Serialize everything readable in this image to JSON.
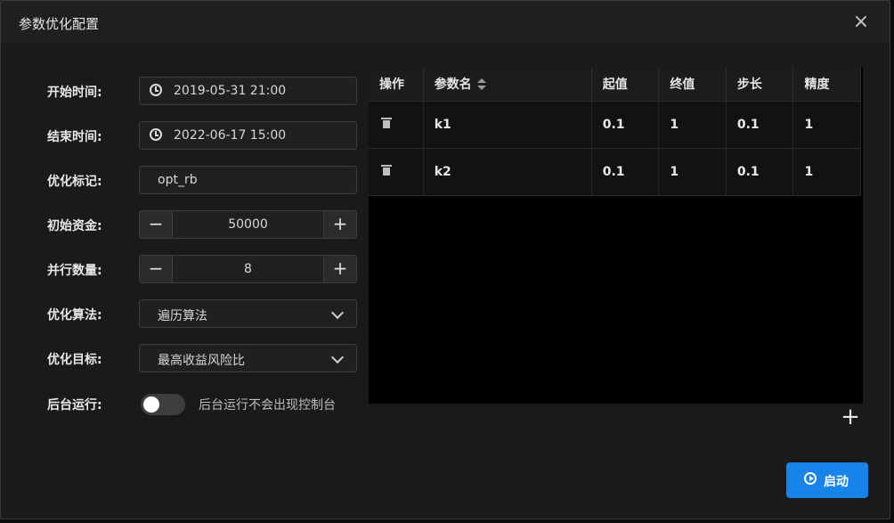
{
  "dialog": {
    "title": "参数优化配置",
    "close_glyph": "×"
  },
  "form": {
    "start_time": {
      "label": "开始时间:",
      "value": "2019-05-31 21:00",
      "icon": "clock-icon"
    },
    "end_time": {
      "label": "结束时间:",
      "value": "2022-06-17 15:00",
      "icon": "clock-icon"
    },
    "opt_tag": {
      "label": "优化标记:",
      "value": "opt_rb"
    },
    "initial_capital": {
      "label": "初始资金:",
      "value": "50000",
      "minus": "−",
      "plus": "+"
    },
    "parallel_count": {
      "label": "并行数量:",
      "value": "8",
      "minus": "−",
      "plus": "+"
    },
    "algorithm": {
      "label": "优化算法:",
      "value": "遍历算法"
    },
    "objective": {
      "label": "优化目标:",
      "value": "最高收益风险比"
    },
    "background_run": {
      "label": "后台运行:",
      "enabled": false,
      "hint": "后台运行不会出现控制台"
    }
  },
  "table": {
    "headers": [
      "操作",
      "参数名",
      "起值",
      "终值",
      "步长",
      "精度"
    ],
    "rows": [
      {
        "name": "k1",
        "start": "0.1",
        "end": "1",
        "step": "0.1",
        "precision": "1"
      },
      {
        "name": "k2",
        "start": "0.1",
        "end": "1",
        "step": "0.1",
        "precision": "1"
      }
    ],
    "add_glyph": "+"
  },
  "actions": {
    "start_label": "启动"
  },
  "colors": {
    "accent": "#1883e8",
    "background": "#1a1a1a",
    "table_bg": "#000000"
  }
}
